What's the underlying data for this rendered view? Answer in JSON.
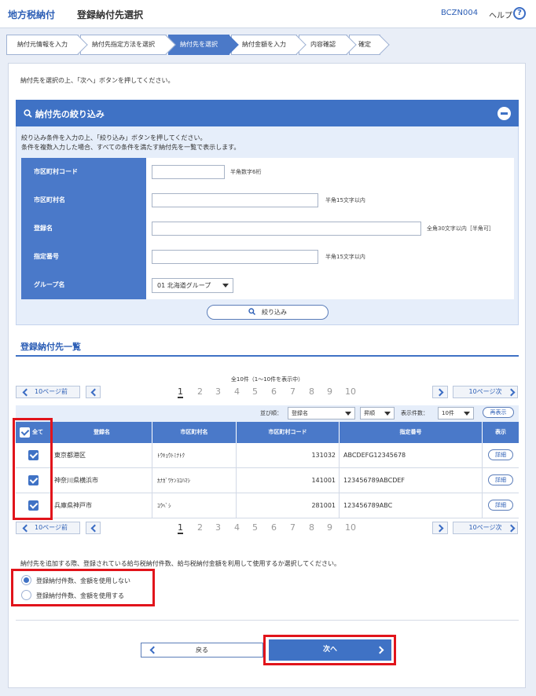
{
  "header": {
    "app": "地方税納付",
    "title": "登録納付先選択",
    "code": "BCZN004",
    "help": "ヘルプ",
    "help_icon": "?"
  },
  "steps": [
    "納付元情報を入力",
    "納付先指定方法を選択",
    "納付先を選択",
    "納付金額を入力",
    "内容確認",
    "確定"
  ],
  "intro": "納付先を選択の上、「次へ」ボタンを押してください。",
  "filter": {
    "title": "納付先の絞り込み",
    "desc1": "絞り込み条件を入力の上、「絞り込み」ボタンを押してください。",
    "desc2": "条件を複数入力した場合、すべての条件を満たす納付先を一覧で表示します。",
    "rows": [
      {
        "label": "市区町村コード",
        "value": "",
        "hint": "半角数字6桁"
      },
      {
        "label": "市区町村名",
        "value": "",
        "hint": "半角15文字以内"
      },
      {
        "label": "登録名",
        "value": "",
        "hint": "全角30文字以内［半角可］"
      },
      {
        "label": "指定番号",
        "value": "",
        "hint": "半角15文字以内"
      },
      {
        "label": "グループ名",
        "value": "01 北海道グループ"
      }
    ],
    "button": "絞り込み"
  },
  "list": {
    "title": "登録納付先一覧",
    "summary": "全10件（1～10件を表示中）",
    "prev10": "10ページ前",
    "next10": "10ページ次",
    "pages": [
      "1",
      "2",
      "3",
      "4",
      "5",
      "6",
      "7",
      "8",
      "9",
      "10"
    ],
    "current_page": "1",
    "sort_label": "並び順：",
    "sort_value": "登録名",
    "order_value": "昇順",
    "count_label": "表示件数：",
    "count_value": "10件",
    "redisplay": "再表示",
    "columns": [
      "全て",
      "登録名",
      "市区町村名",
      "市区町村コード",
      "指定番号",
      "表示"
    ],
    "rows": [
      {
        "name": "東京都港区",
        "city": "ﾄｳｷｮｳﾄﾐﾅﾄｸ",
        "code": "131032",
        "num": "ABCDEFG12345678",
        "detail": "詳細"
      },
      {
        "name": "神奈川県横浜市",
        "city": "ｶﾅｶﾞﾜｹﾝﾖｺﾊﾏｼ",
        "code": "141001",
        "num": "123456789ABCDEF",
        "detail": "詳細"
      },
      {
        "name": "兵庫県神戸市",
        "city": "ｺｳﾍﾞｼ",
        "code": "281001",
        "num": "123456789ABC",
        "detail": "詳細"
      }
    ]
  },
  "option": {
    "question": "納付先を追加する際、登録されている給与税納付件数、給与税納付金額を利用して使用するか選択してください。",
    "choices": [
      "登録納付件数、金額を使用しない",
      "登録納付件数、金額を使用する"
    ],
    "selected": 0
  },
  "footer": {
    "back": "戻る",
    "next": "次へ"
  }
}
